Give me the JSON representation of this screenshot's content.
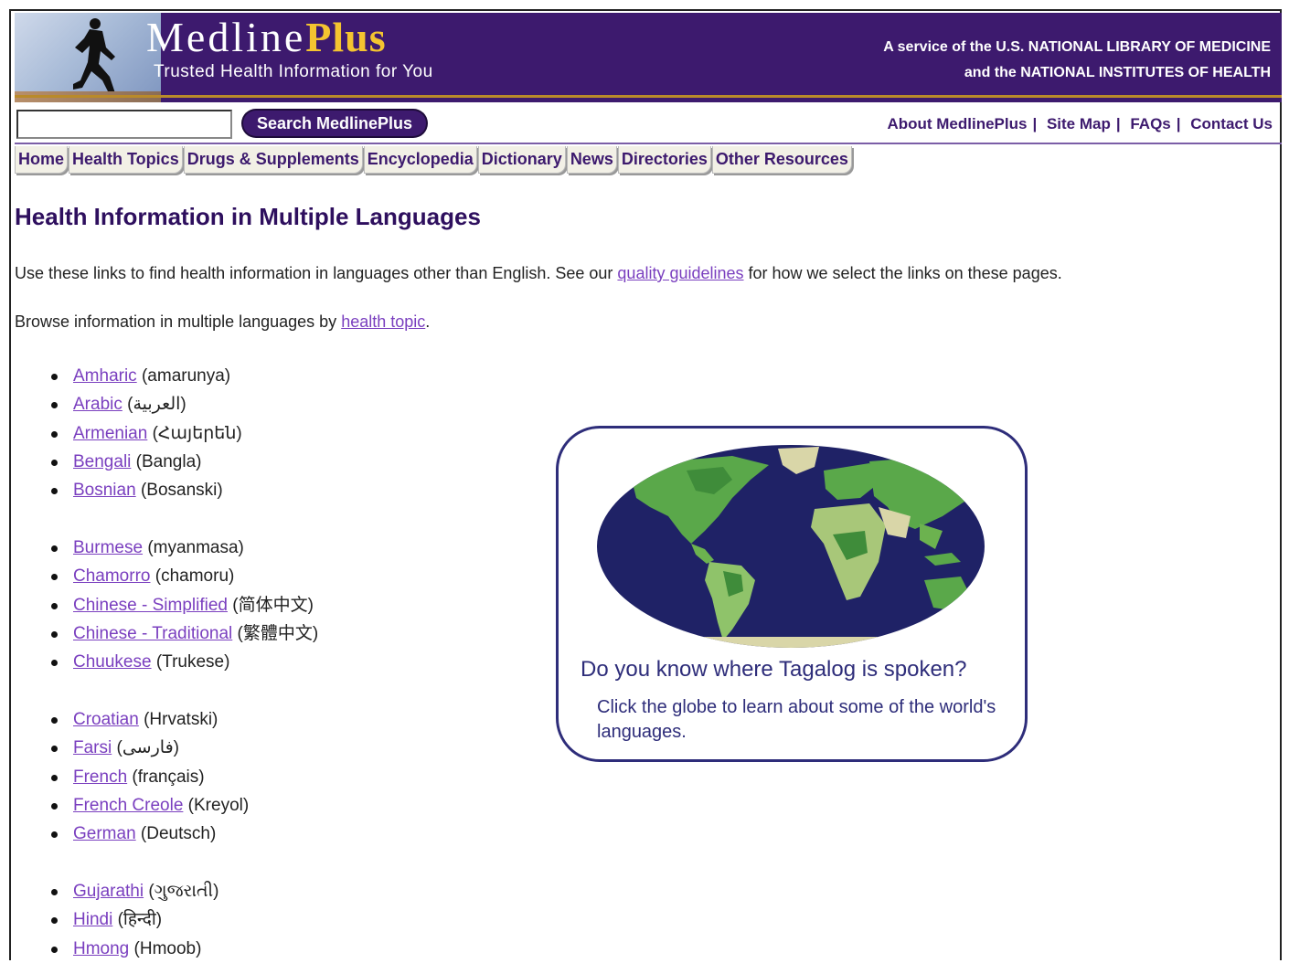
{
  "header": {
    "brand_main": "Medline",
    "brand_plus": "Plus",
    "tagline": "Trusted Health Information for You",
    "service_line1": "A service of the U.S. NATIONAL LIBRARY OF MEDICINE",
    "service_line2": "and the NATIONAL INSTITUTES OF HEALTH",
    "icon": "runner-icon"
  },
  "search": {
    "value": "",
    "button_label": "Search MedlinePlus"
  },
  "toplinks": [
    "About MedlinePlus",
    "Site Map",
    "FAQs",
    "Contact Us"
  ],
  "tabs": [
    "Home",
    "Health Topics",
    "Drugs & Supplements",
    "Encyclopedia",
    "Dictionary",
    "News",
    "Directories",
    "Other Resources"
  ],
  "page": {
    "title": "Health Information in Multiple Languages",
    "intro_before": "Use these links to find health information in languages other than English. See our ",
    "intro_link": "quality guidelines",
    "intro_after": " for how we select the links on these pages.",
    "browse_before": "Browse information in multiple languages by ",
    "browse_link": "health topic",
    "browse_after": "."
  },
  "languages": [
    [
      {
        "name": "Amharic",
        "native": "(amarunya)"
      },
      {
        "name": "Arabic",
        "native": "(العربية)"
      },
      {
        "name": "Armenian",
        "native": "(Հայերեն)"
      },
      {
        "name": "Bengali",
        "native": "(Bangla)"
      },
      {
        "name": "Bosnian",
        "native": "(Bosanski)"
      }
    ],
    [
      {
        "name": "Burmese",
        "native": "(myanmasa)"
      },
      {
        "name": "Chamorro",
        "native": "(chamoru)"
      },
      {
        "name": "Chinese - Simplified",
        "native": "(简体中文)"
      },
      {
        "name": "Chinese - Traditional",
        "native": "(繁體中文)"
      },
      {
        "name": "Chuukese",
        "native": "(Trukese)"
      }
    ],
    [
      {
        "name": "Croatian",
        "native": "(Hrvatski)"
      },
      {
        "name": "Farsi",
        "native": "(فارسی)"
      },
      {
        "name": "French",
        "native": "(français)"
      },
      {
        "name": "French Creole",
        "native": "(Kreyol)"
      },
      {
        "name": "German",
        "native": "(Deutsch)"
      }
    ],
    [
      {
        "name": "Gujarathi",
        "native": "(ગુજરાતી)"
      },
      {
        "name": "Hindi",
        "native": "(हिन्दी)"
      },
      {
        "name": "Hmong",
        "native": "(Hmoob)"
      }
    ]
  ],
  "globe_box": {
    "question": "Do you know where Tagalog is spoken?",
    "subtext": "Click the globe to learn about some of the world's languages.",
    "icon": "world-map-icon"
  },
  "colors": {
    "brand_purple": "#3d1a6e",
    "link": "#7a3fbf",
    "gold": "#f4c430",
    "ocean": "#1f2266",
    "land": "#5aa84a"
  }
}
